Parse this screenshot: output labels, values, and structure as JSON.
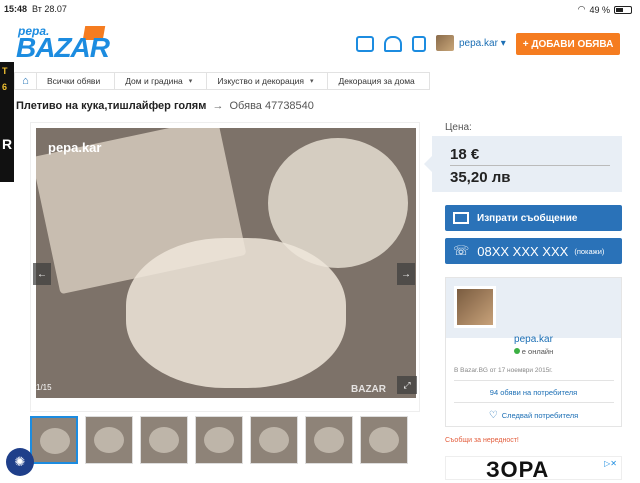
{
  "status_bar": {
    "time": "15:48",
    "date": "Вт 28.07",
    "battery": "49 %"
  },
  "header": {
    "logo_small": "pepa.",
    "logo_big": "BAZAR",
    "user_name": "pepa.kar",
    "user_caret": "▾",
    "add_button": "+ ДОБАВИ ОБЯВА"
  },
  "breadcrumbs": [
    {
      "label": "Всички обяви"
    },
    {
      "label": "Дом и градина",
      "caret": "▾"
    },
    {
      "label": "Изкуство и декорация",
      "caret": "▾"
    },
    {
      "label": "Декорация за дома"
    }
  ],
  "listing": {
    "title": "Плетиво на кука,тишлайфер голям",
    "arrow": "→",
    "ad_id": "Обява 47738540"
  },
  "gallery": {
    "watermark": "pepa.kar",
    "bazar_mark": "BAZAR",
    "counter": "1/15",
    "prev": "←",
    "next": "→",
    "fullscreen": "⤢"
  },
  "side_ad": {
    "lines": [
      "T",
      "6",
      "R"
    ]
  },
  "price": {
    "label": "Цена:",
    "eur": "18 €",
    "bgn": "35,20 лв"
  },
  "actions": {
    "message": "Изпрати съобщение",
    "phone": "08XX XXX XXX",
    "phone_show": "(покажи)"
  },
  "seller": {
    "name": "pepa.kar",
    "online": "е онлайн",
    "since": "В Bazar.BG от 17 ноември 2015г.",
    "ads_count": "94 обяви на потребителя",
    "follow": "Следвай потребителя"
  },
  "report": "Съобщи за нередност!",
  "ad_zone": {
    "brand": "ЗОРА",
    "ad_indicator": "▷✕"
  },
  "colors": {
    "brand_blue": "#1c8ce0",
    "accent_orange": "#f57c20",
    "button_blue": "#2a72b8"
  }
}
